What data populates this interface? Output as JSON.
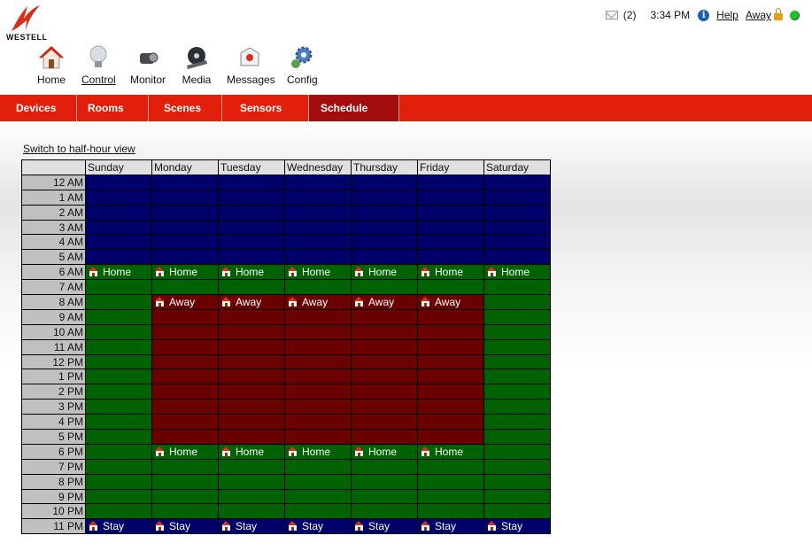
{
  "brand": {
    "name": "WESTELL"
  },
  "topbar": {
    "message_count": "(2)",
    "time": "3:34 PM",
    "help_label": "Help",
    "mode_label": "Away",
    "status_color": "#22c22a"
  },
  "mainnav": [
    {
      "label": "Home",
      "icon": "house-icon",
      "active": false
    },
    {
      "label": "Control",
      "icon": "lightbulb-icon",
      "active": true
    },
    {
      "label": "Monitor",
      "icon": "camera-icon",
      "active": false
    },
    {
      "label": "Media",
      "icon": "film-reel-icon",
      "active": false
    },
    {
      "label": "Messages",
      "icon": "messages-icon",
      "active": false
    },
    {
      "label": "Config",
      "icon": "gear-icon",
      "active": false
    }
  ],
  "subnav": [
    {
      "label": "Devices",
      "active": false
    },
    {
      "label": "Rooms",
      "active": false
    },
    {
      "label": "Scenes",
      "active": false
    },
    {
      "label": "Sensors",
      "active": false
    },
    {
      "label": "Schedule",
      "active": true
    }
  ],
  "schedule": {
    "switch_link": "Switch to half-hour view",
    "days": [
      "Sunday",
      "Monday",
      "Tuesday",
      "Wednesday",
      "Thursday",
      "Friday",
      "Saturday"
    ],
    "hours": [
      "12 AM",
      "1 AM",
      "2 AM",
      "3 AM",
      "4 AM",
      "5 AM",
      "6 AM",
      "7 AM",
      "8 AM",
      "9 AM",
      "10 AM",
      "11 AM",
      "12 PM",
      "1 PM",
      "2 PM",
      "3 PM",
      "4 PM",
      "5 PM",
      "6 PM",
      "7 PM",
      "8 PM",
      "9 PM",
      "10 PM",
      "11 PM"
    ],
    "colors": {
      "sleep": "#00006b",
      "home": "#006200",
      "away": "#6b0000",
      "stay": "#00006b"
    },
    "grid": [
      [
        "sleep",
        "sleep",
        "sleep",
        "sleep",
        "sleep",
        "sleep",
        "sleep"
      ],
      [
        "sleep",
        "sleep",
        "sleep",
        "sleep",
        "sleep",
        "sleep",
        "sleep"
      ],
      [
        "sleep",
        "sleep",
        "sleep",
        "sleep",
        "sleep",
        "sleep",
        "sleep"
      ],
      [
        "sleep",
        "sleep",
        "sleep",
        "sleep",
        "sleep",
        "sleep",
        "sleep"
      ],
      [
        "sleep",
        "sleep",
        "sleep",
        "sleep",
        "sleep",
        "sleep",
        "sleep"
      ],
      [
        "sleep",
        "sleep",
        "sleep",
        "sleep",
        "sleep",
        "sleep",
        "sleep"
      ],
      [
        "home",
        "home",
        "home",
        "home",
        "home",
        "home",
        "home"
      ],
      [
        "home",
        "home",
        "home",
        "home",
        "home",
        "home",
        "home"
      ],
      [
        "home",
        "away",
        "away",
        "away",
        "away",
        "away",
        "home"
      ],
      [
        "home",
        "away",
        "away",
        "away",
        "away",
        "away",
        "home"
      ],
      [
        "home",
        "away",
        "away",
        "away",
        "away",
        "away",
        "home"
      ],
      [
        "home",
        "away",
        "away",
        "away",
        "away",
        "away",
        "home"
      ],
      [
        "home",
        "away",
        "away",
        "away",
        "away",
        "away",
        "home"
      ],
      [
        "home",
        "away",
        "away",
        "away",
        "away",
        "away",
        "home"
      ],
      [
        "home",
        "away",
        "away",
        "away",
        "away",
        "away",
        "home"
      ],
      [
        "home",
        "away",
        "away",
        "away",
        "away",
        "away",
        "home"
      ],
      [
        "home",
        "away",
        "away",
        "away",
        "away",
        "away",
        "home"
      ],
      [
        "home",
        "away",
        "away",
        "away",
        "away",
        "away",
        "home"
      ],
      [
        "home",
        "home",
        "home",
        "home",
        "home",
        "home",
        "home"
      ],
      [
        "home",
        "home",
        "home",
        "home",
        "home",
        "home",
        "home"
      ],
      [
        "home",
        "home",
        "home",
        "home",
        "home",
        "home",
        "home"
      ],
      [
        "home",
        "home",
        "home",
        "home",
        "home",
        "home",
        "home"
      ],
      [
        "home",
        "home",
        "home",
        "home",
        "home",
        "home",
        "home"
      ],
      [
        "stay",
        "stay",
        "stay",
        "stay",
        "stay",
        "stay",
        "stay"
      ]
    ],
    "labels": [
      {
        "row": 6,
        "col": 0,
        "text": "Home"
      },
      {
        "row": 6,
        "col": 1,
        "text": "Home"
      },
      {
        "row": 6,
        "col": 2,
        "text": "Home"
      },
      {
        "row": 6,
        "col": 3,
        "text": "Home"
      },
      {
        "row": 6,
        "col": 4,
        "text": "Home"
      },
      {
        "row": 6,
        "col": 5,
        "text": "Home"
      },
      {
        "row": 6,
        "col": 6,
        "text": "Home"
      },
      {
        "row": 8,
        "col": 1,
        "text": "Away"
      },
      {
        "row": 8,
        "col": 2,
        "text": "Away"
      },
      {
        "row": 8,
        "col": 3,
        "text": "Away"
      },
      {
        "row": 8,
        "col": 4,
        "text": "Away"
      },
      {
        "row": 8,
        "col": 5,
        "text": "Away"
      },
      {
        "row": 18,
        "col": 1,
        "text": "Home"
      },
      {
        "row": 18,
        "col": 2,
        "text": "Home"
      },
      {
        "row": 18,
        "col": 3,
        "text": "Home"
      },
      {
        "row": 18,
        "col": 4,
        "text": "Home"
      },
      {
        "row": 18,
        "col": 5,
        "text": "Home"
      },
      {
        "row": 23,
        "col": 0,
        "text": "Stay"
      },
      {
        "row": 23,
        "col": 1,
        "text": "Stay"
      },
      {
        "row": 23,
        "col": 2,
        "text": "Stay"
      },
      {
        "row": 23,
        "col": 3,
        "text": "Stay"
      },
      {
        "row": 23,
        "col": 4,
        "text": "Stay"
      },
      {
        "row": 23,
        "col": 5,
        "text": "Stay"
      },
      {
        "row": 23,
        "col": 6,
        "text": "Stay"
      }
    ]
  }
}
